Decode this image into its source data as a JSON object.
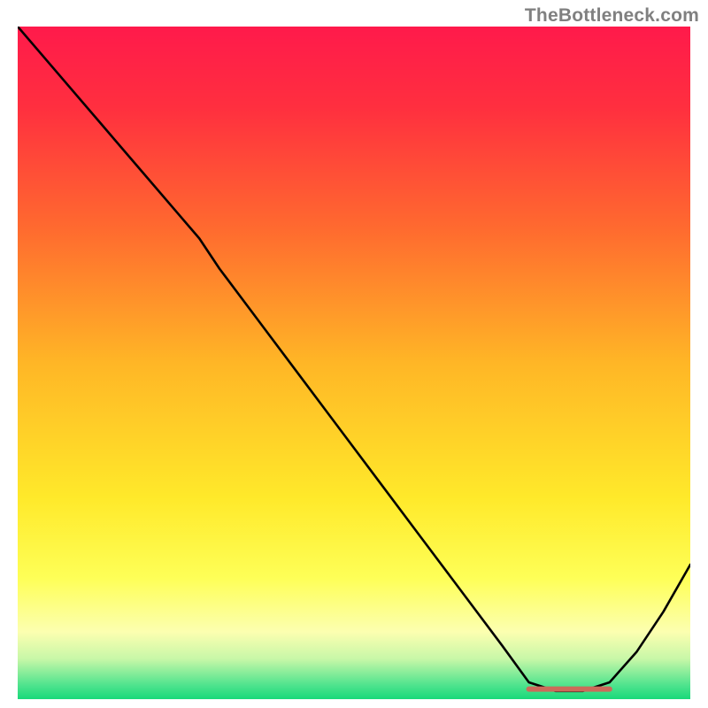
{
  "watermark": "TheBottleneck.com",
  "chart_data": {
    "type": "line",
    "title": "",
    "xlabel": "",
    "ylabel": "",
    "xlim": [
      0,
      100
    ],
    "ylim": [
      0,
      100
    ],
    "grid": false,
    "legend": null,
    "annotations": [],
    "background_gradient_stops": [
      {
        "offset": 0.0,
        "color": "#ff1a4b"
      },
      {
        "offset": 0.12,
        "color": "#ff2f3f"
      },
      {
        "offset": 0.3,
        "color": "#ff6a2f"
      },
      {
        "offset": 0.5,
        "color": "#ffb626"
      },
      {
        "offset": 0.7,
        "color": "#ffe92a"
      },
      {
        "offset": 0.82,
        "color": "#feff57"
      },
      {
        "offset": 0.9,
        "color": "#fcffb0"
      },
      {
        "offset": 0.94,
        "color": "#c8f7a8"
      },
      {
        "offset": 0.98,
        "color": "#4de38d"
      },
      {
        "offset": 1.0,
        "color": "#19d97a"
      }
    ],
    "series": [
      {
        "name": "bottleneck-curve",
        "color": "#000000",
        "width": 2.6,
        "x": [
          0,
          6,
          12,
          18,
          24,
          27,
          30,
          36,
          42,
          48,
          54,
          60,
          66,
          72,
          76,
          80,
          84,
          88,
          92,
          96,
          100
        ],
        "y": [
          100,
          93,
          86,
          79,
          72,
          68.5,
          64,
          56,
          48,
          40,
          32,
          24,
          16,
          8,
          2.5,
          1.2,
          1.2,
          2.5,
          7,
          13,
          20
        ]
      }
    ],
    "marker": {
      "name": "optimal-range-marker",
      "color": "#cc6a5a",
      "x": [
        76,
        88
      ],
      "y": 1.5,
      "thickness": 6
    }
  }
}
